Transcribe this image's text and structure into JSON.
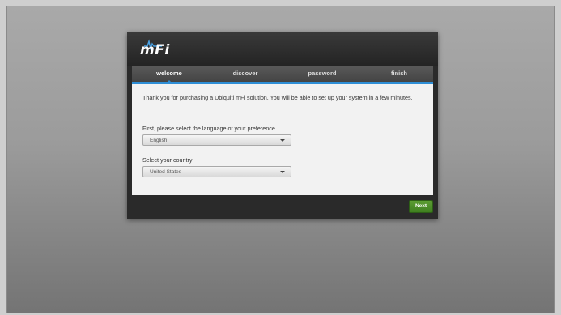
{
  "app": {
    "logo_text": "mFi"
  },
  "wizard": {
    "tabs": [
      {
        "label": "welcome",
        "active": true
      },
      {
        "label": "discover",
        "active": false
      },
      {
        "label": "password",
        "active": false
      },
      {
        "label": "finish",
        "active": false
      }
    ],
    "intro_text": "Thank you for purchasing a Ubiquiti mFi solution. You will be able to set up your system in a few minutes.",
    "language": {
      "label": "First, please select the language of your preference",
      "selected": "English"
    },
    "country": {
      "label": "Select your country",
      "selected": "United States"
    },
    "next_label": "Next"
  },
  "colors": {
    "accent": "#2e8ed6",
    "next_button": "#4a8a28",
    "panel": "#2a2a2a"
  }
}
